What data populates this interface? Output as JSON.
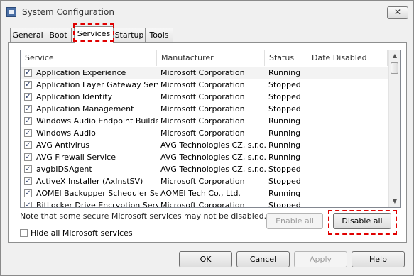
{
  "window": {
    "title": "System Configuration",
    "close_label": "✕"
  },
  "tabs": [
    {
      "label": "General"
    },
    {
      "label": "Boot"
    },
    {
      "label": "Services"
    },
    {
      "label": "Startup"
    },
    {
      "label": "Tools"
    }
  ],
  "active_tab": "Services",
  "table": {
    "columns": [
      "Service",
      "Manufacturer",
      "Status",
      "Date Disabled"
    ],
    "rows": [
      {
        "service": "Application Experience",
        "manufacturer": "Microsoft Corporation",
        "status": "Running",
        "date": "",
        "checked": true
      },
      {
        "service": "Application Layer Gateway Service",
        "manufacturer": "Microsoft Corporation",
        "status": "Stopped",
        "date": "",
        "checked": true
      },
      {
        "service": "Application Identity",
        "manufacturer": "Microsoft Corporation",
        "status": "Stopped",
        "date": "",
        "checked": true
      },
      {
        "service": "Application Management",
        "manufacturer": "Microsoft Corporation",
        "status": "Stopped",
        "date": "",
        "checked": true
      },
      {
        "service": "Windows Audio Endpoint Builder",
        "manufacturer": "Microsoft Corporation",
        "status": "Running",
        "date": "",
        "checked": true
      },
      {
        "service": "Windows Audio",
        "manufacturer": "Microsoft Corporation",
        "status": "Running",
        "date": "",
        "checked": true
      },
      {
        "service": "AVG Antivirus",
        "manufacturer": "AVG Technologies CZ, s.r.o.",
        "status": "Running",
        "date": "",
        "checked": true
      },
      {
        "service": "AVG Firewall Service",
        "manufacturer": "AVG Technologies CZ, s.r.o.",
        "status": "Running",
        "date": "",
        "checked": true
      },
      {
        "service": "avgbIDSAgent",
        "manufacturer": "AVG Technologies CZ, s.r.o.",
        "status": "Stopped",
        "date": "",
        "checked": true
      },
      {
        "service": "ActiveX Installer (AxInstSV)",
        "manufacturer": "Microsoft Corporation",
        "status": "Stopped",
        "date": "",
        "checked": true
      },
      {
        "service": "AOMEI Backupper Scheduler Ser...",
        "manufacturer": "AOMEI Tech Co., Ltd.",
        "status": "Running",
        "date": "",
        "checked": true
      },
      {
        "service": "BitLocker Drive Encryption Service",
        "manufacturer": "Microsoft Corporation",
        "status": "Stopped",
        "date": "",
        "checked": true
      }
    ]
  },
  "note": "Note that some secure Microsoft services may not be disabled.",
  "buttons": {
    "enable_all": "Enable all",
    "disable_all": "Disable all",
    "ok": "OK",
    "cancel": "Cancel",
    "apply": "Apply",
    "help": "Help"
  },
  "hide_ms_label": "Hide all Microsoft services",
  "hide_ms_checked": false,
  "colors": {
    "highlight": "#e00000",
    "selected_row": "#f3f3f3"
  }
}
